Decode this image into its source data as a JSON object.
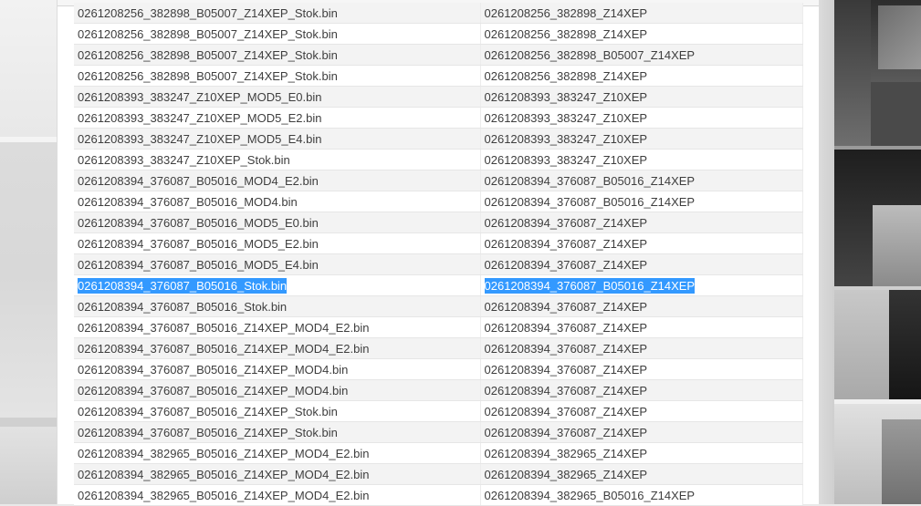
{
  "rows": [
    {
      "file": "0261208256_382898_B05007_Z14XEP_Stok.bin",
      "ecu": "0261208256_382898_Z14XEP"
    },
    {
      "file": "0261208256_382898_B05007_Z14XEP_Stok.bin",
      "ecu": "0261208256_382898_Z14XEP"
    },
    {
      "file": "0261208256_382898_B05007_Z14XEP_Stok.bin",
      "ecu": "0261208256_382898_B05007_Z14XEP"
    },
    {
      "file": "0261208256_382898_B05007_Z14XEP_Stok.bin",
      "ecu": "0261208256_382898_Z14XEP"
    },
    {
      "file": "0261208393_383247_Z10XEP_MOD5_E0.bin",
      "ecu": "0261208393_383247_Z10XEP"
    },
    {
      "file": "0261208393_383247_Z10XEP_MOD5_E2.bin",
      "ecu": "0261208393_383247_Z10XEP"
    },
    {
      "file": "0261208393_383247_Z10XEP_MOD5_E4.bin",
      "ecu": "0261208393_383247_Z10XEP"
    },
    {
      "file": "0261208393_383247_Z10XEP_Stok.bin",
      "ecu": "0261208393_383247_Z10XEP"
    },
    {
      "file": "0261208394_376087_B05016_MOD4_E2.bin",
      "ecu": "0261208394_376087_B05016_Z14XEP"
    },
    {
      "file": "0261208394_376087_B05016_MOD4.bin",
      "ecu": "0261208394_376087_B05016_Z14XEP"
    },
    {
      "file": "0261208394_376087_B05016_MOD5_E0.bin",
      "ecu": "0261208394_376087_Z14XEP"
    },
    {
      "file": "0261208394_376087_B05016_MOD5_E2.bin",
      "ecu": "0261208394_376087_Z14XEP"
    },
    {
      "file": "0261208394_376087_B05016_MOD5_E4.bin",
      "ecu": "0261208394_376087_Z14XEP"
    },
    {
      "file": "0261208394_376087_B05016_Stok.bin",
      "ecu": "0261208394_376087_B05016_Z14XEP",
      "selected": true
    },
    {
      "file": "0261208394_376087_B05016_Stok.bin",
      "ecu": "0261208394_376087_Z14XEP"
    },
    {
      "file": "0261208394_376087_B05016_Z14XEP_MOD4_E2.bin",
      "ecu": "0261208394_376087_Z14XEP"
    },
    {
      "file": "0261208394_376087_B05016_Z14XEP_MOD4_E2.bin",
      "ecu": "0261208394_376087_Z14XEP"
    },
    {
      "file": "0261208394_376087_B05016_Z14XEP_MOD4.bin",
      "ecu": "0261208394_376087_Z14XEP"
    },
    {
      "file": "0261208394_376087_B05016_Z14XEP_MOD4.bin",
      "ecu": "0261208394_376087_Z14XEP"
    },
    {
      "file": "0261208394_376087_B05016_Z14XEP_Stok.bin",
      "ecu": "0261208394_376087_Z14XEP"
    },
    {
      "file": "0261208394_376087_B05016_Z14XEP_Stok.bin",
      "ecu": "0261208394_376087_Z14XEP"
    },
    {
      "file": "0261208394_382965_B05016_Z14XEP_MOD4_E2.bin",
      "ecu": "0261208394_382965_Z14XEP"
    },
    {
      "file": "0261208394_382965_B05016_Z14XEP_MOD4_E2.bin",
      "ecu": "0261208394_382965_Z14XEP"
    },
    {
      "file": "0261208394_382965_B05016_Z14XEP_MOD4_E2.bin",
      "ecu": "0261208394_382965_B05016_Z14XEP"
    }
  ],
  "colors": {
    "selection": "#3399ff",
    "row_alt": "#f3f3f3",
    "text": "#3e3e3e"
  }
}
